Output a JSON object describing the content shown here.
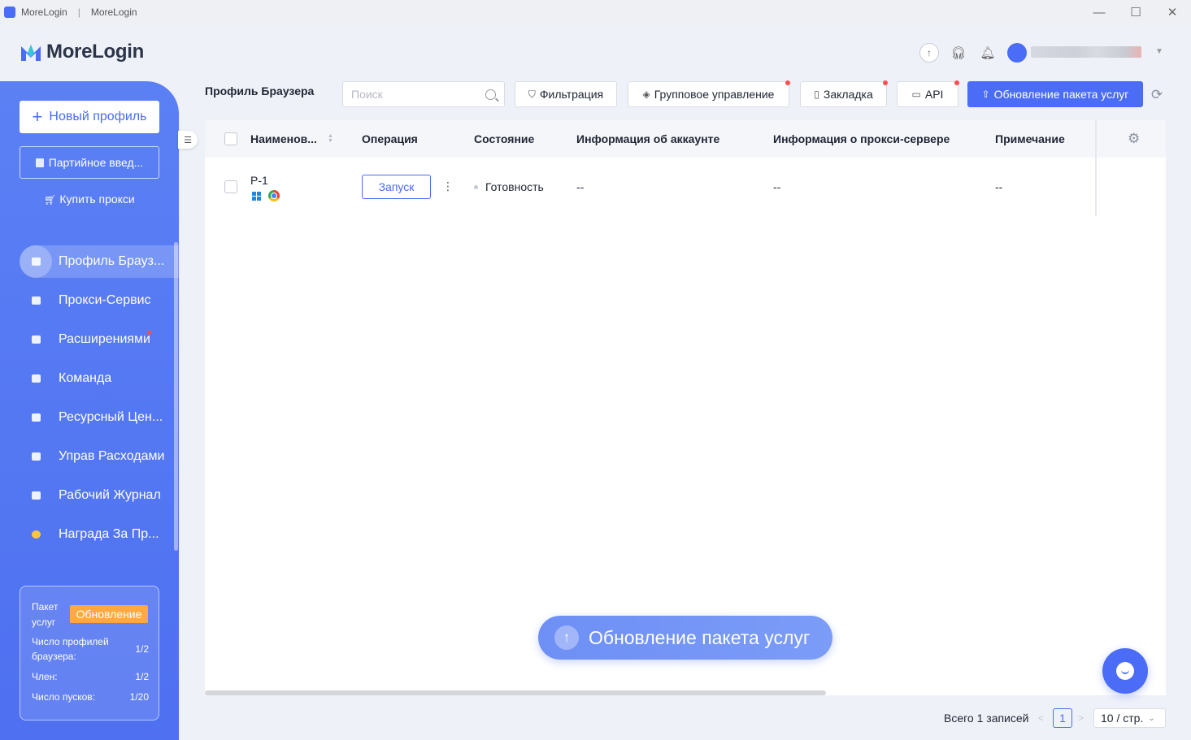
{
  "window": {
    "app_name": "MoreLogin",
    "title": "MoreLogin",
    "separator": "|",
    "minimize": "—",
    "maximize": "☐",
    "close": "✕"
  },
  "header": {
    "logo_text": "MoreLogin",
    "icons": [
      "upload-icon",
      "headset-icon",
      "bell-icon"
    ]
  },
  "sidebar": {
    "new_profile": "Новый профиль",
    "batch_import": "Партийное введ...",
    "buy_proxy": "Купить прокси",
    "items": [
      {
        "label": "Профиль Брауз...",
        "active": true
      },
      {
        "label": "Прокси-Сервис",
        "active": false
      },
      {
        "label": "Расширениями",
        "active": false,
        "badge": true
      },
      {
        "label": "Команда",
        "active": false
      },
      {
        "label": "Ресурсный Цен...",
        "active": false
      },
      {
        "label": "Управ Расходами",
        "active": false
      },
      {
        "label": "Рабочий Журнал",
        "active": false
      },
      {
        "label": "Награда За Пр...",
        "active": false
      }
    ],
    "plan": {
      "title": "Пакет услуг",
      "upgrade": "Обновление",
      "rows": [
        {
          "label": "Число профилей браузера:",
          "value": "1/2"
        },
        {
          "label": "Член:",
          "value": "1/2"
        },
        {
          "label": "Число пусков:",
          "value": "1/20"
        }
      ]
    }
  },
  "toolbar": {
    "page_title": "Профиль Браузера",
    "search_placeholder": "Поиск",
    "filter": "Фильтрация",
    "group_manage": "Групповое управление",
    "bookmark": "Закладка",
    "api": "API",
    "upgrade": "Обновление пакета услуг"
  },
  "table": {
    "columns": [
      "Наименов...",
      "Операция",
      "Состояние",
      "Информация об аккаунте",
      "Информация о прокси-сервере",
      "Примечание"
    ],
    "rows": [
      {
        "name": "P-1",
        "operation": "Запуск",
        "status": "Готовность",
        "account": "--",
        "proxy": "--",
        "note": "--"
      }
    ]
  },
  "floating_upgrade": "Обновление пакета услуг",
  "pagination": {
    "total": "Всего 1 записей",
    "page": "1",
    "page_size": "10 / стр."
  },
  "colors": {
    "accent": "#4a6cf7",
    "sidebar": "#5475f3",
    "warning": "#ffa940",
    "badge": "#ff4d4f"
  }
}
